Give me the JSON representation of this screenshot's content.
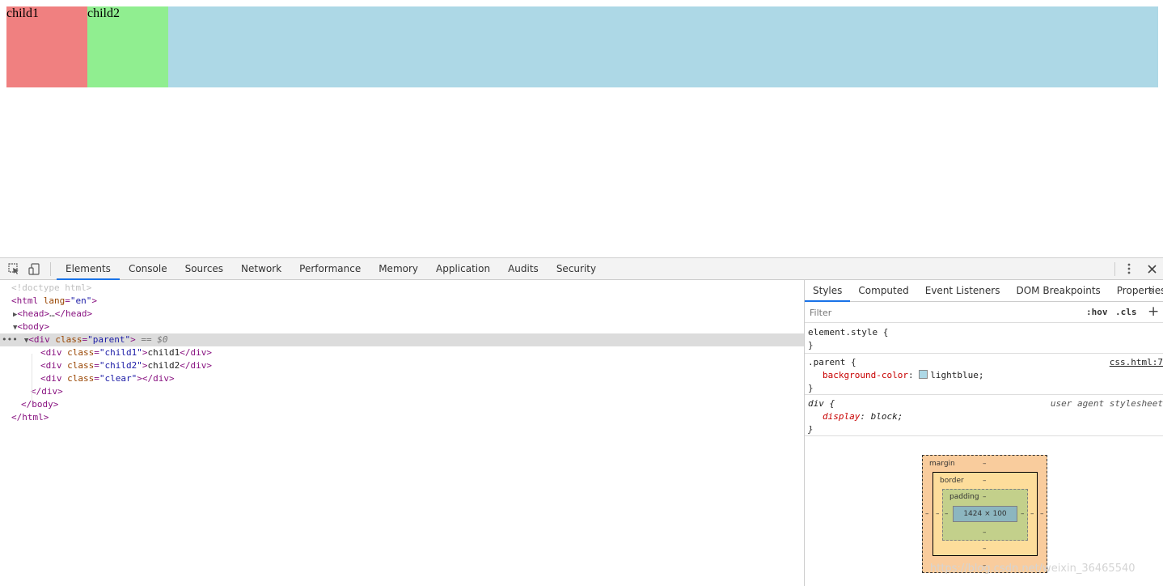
{
  "page": {
    "child1_text": "child1",
    "child2_text": "child2",
    "colors": {
      "parent": "#add8e6",
      "child1": "#f08080",
      "child2": "#90ee90"
    }
  },
  "devtools": {
    "toolbar": {
      "inspect_icon": "inspect-element-icon",
      "device_icon": "device-toolbar-icon",
      "tabs": [
        "Elements",
        "Console",
        "Sources",
        "Network",
        "Performance",
        "Memory",
        "Application",
        "Audits",
        "Security"
      ],
      "active_tab": "Elements",
      "menu_icon": "more-vert-icon",
      "close_icon": "close-icon"
    },
    "dom": {
      "doctype": "<!doctype html>",
      "html_open_tag": "html",
      "html_attr_name": "lang",
      "html_attr_val": "\"en\"",
      "head_collapsed": "head",
      "head_ellipsis": "…",
      "body_tag": "body",
      "parent_tag": "div",
      "parent_attr_name": "class",
      "parent_attr_val": "\"parent\"",
      "selected_marker": "== $0",
      "children": [
        {
          "tag": "div",
          "attr_name": "class",
          "attr_val": "\"child1\"",
          "text": "child1"
        },
        {
          "tag": "div",
          "attr_name": "class",
          "attr_val": "\"child2\"",
          "text": "child2"
        },
        {
          "tag": "div",
          "attr_name": "class",
          "attr_val": "\"clear\"",
          "text": ""
        }
      ]
    },
    "sidebar": {
      "tabs": [
        "Styles",
        "Computed",
        "Event Listeners",
        "DOM Breakpoints",
        "Properties"
      ],
      "active_tab": "Styles",
      "more_icon": "chevron-double-right-icon",
      "filter_placeholder": "Filter",
      "hov_label": ":hov",
      "cls_label": ".cls",
      "add_label": "+",
      "rules": {
        "element_style": "element.style {",
        "parent_selector": ".parent {",
        "parent_source": "css.html:7",
        "parent_prop": "background-color",
        "parent_value": "lightblue;",
        "div_selector": "div {",
        "div_source": "user agent stylesheet",
        "div_prop": "display",
        "div_value": "block;",
        "close_brace": "}"
      },
      "box_model": {
        "margin_label": "margin",
        "border_label": "border",
        "padding_label": "padding",
        "dash": "–",
        "content_size": "1424 × 100"
      }
    }
  },
  "watermark": "https://blog.csdn.net/weixin_36465540"
}
